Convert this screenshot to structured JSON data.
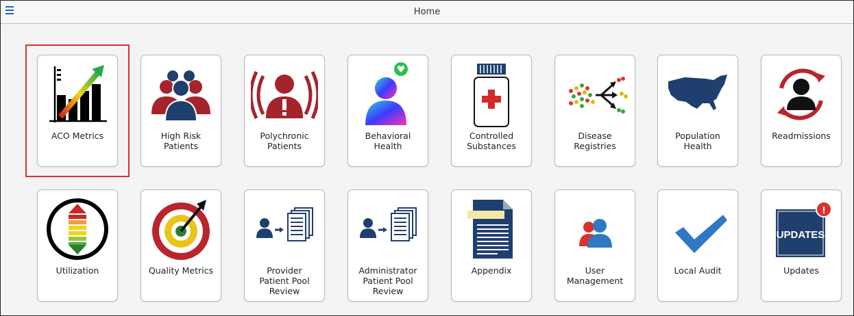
{
  "header": {
    "title": "Home",
    "menu_icon": "hamburger-menu-icon"
  },
  "tiles": [
    {
      "label": "ACO Metrics",
      "icon": "bar-chart-trend-icon",
      "selected": true
    },
    {
      "label": "High Risk\nPatients",
      "icon": "patient-group-icon"
    },
    {
      "label": "Polychronic\nPatients",
      "icon": "patient-alert-icon"
    },
    {
      "label": "Behavioral\nHealth",
      "icon": "heart-mind-icon"
    },
    {
      "label": "Controlled\nSubstances",
      "icon": "pill-bottle-icon"
    },
    {
      "label": "Disease\nRegistries",
      "icon": "population-network-icon"
    },
    {
      "label": "Population\nHealth",
      "icon": "usa-map-icon"
    },
    {
      "label": "Readmissions",
      "icon": "readmission-cycle-icon"
    },
    {
      "label": "Utilization",
      "icon": "utilization-gauge-icon"
    },
    {
      "label": "Quality Metrics",
      "icon": "target-icon"
    },
    {
      "label": "Provider\nPatient Pool\nReview",
      "icon": "provider-documents-icon"
    },
    {
      "label": "Administrator\nPatient Pool\nReview",
      "icon": "administrator-documents-icon"
    },
    {
      "label": "Appendix",
      "icon": "document-icon"
    },
    {
      "label": "User\nManagement",
      "icon": "users-icon"
    },
    {
      "label": "Local Audit",
      "icon": "checkmark-icon"
    },
    {
      "label": "Updates",
      "icon": "updates-alert-icon",
      "icon_text": "UPDATES",
      "badge": "!"
    }
  ],
  "colors": {
    "accent": "#1c5fcf",
    "selection": "#d9322d",
    "navy": "#1f3f6e",
    "crimson": "#a5242b"
  }
}
